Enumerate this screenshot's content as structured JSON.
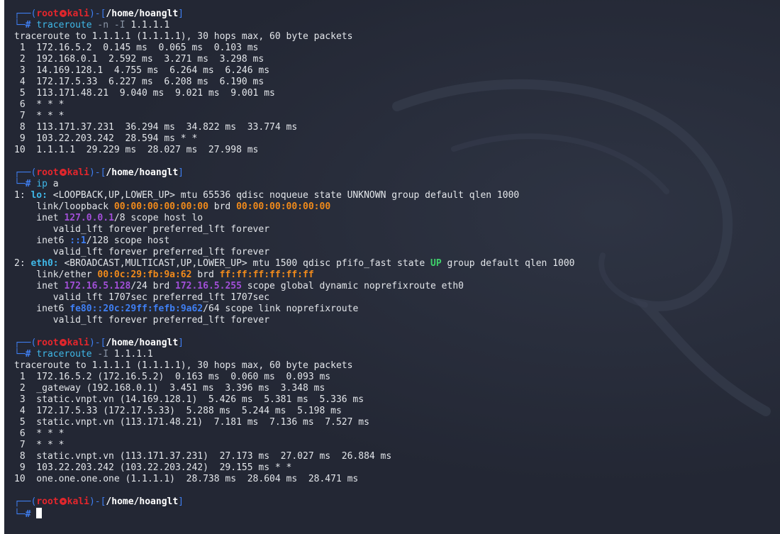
{
  "prompt": {
    "open": "┌──(",
    "user": "root",
    "host": "kali",
    "mid": ")-[",
    "path": "/home/hoanglt",
    "close": "]",
    "second": "└─",
    "hash": "#"
  },
  "block1": {
    "cmd": "traceroute",
    "opts": " -n -I",
    "arg": " 1.1.1.1",
    "header": "traceroute to 1.1.1.1 (1.1.1.1), 30 hops max, 60 byte packets",
    "hops": [
      " 1  172.16.5.2  0.145 ms  0.065 ms  0.103 ms",
      " 2  192.168.0.1  2.592 ms  3.271 ms  3.298 ms",
      " 3  14.169.128.1  4.755 ms  6.264 ms  6.246 ms",
      " 4  172.17.5.33  6.227 ms  6.208 ms  6.190 ms",
      " 5  113.171.48.21  9.040 ms  9.021 ms  9.001 ms",
      " 6  * * *",
      " 7  * * *",
      " 8  113.171.37.231  36.294 ms  34.822 ms  33.774 ms",
      " 9  103.22.203.242  28.594 ms * *",
      "10  1.1.1.1  29.229 ms  28.027 ms  27.998 ms"
    ]
  },
  "block2": {
    "cmd": "ip",
    "arg": " a",
    "lo": {
      "num": "1: ",
      "name": "lo:",
      "rest": " <LOOPBACK,UP,LOWER_UP> mtu 65536 qdisc noqueue state UNKNOWN group default qlen 1000",
      "link_pre": "    link/loopback ",
      "mac": "00:00:00:00:00:00",
      "brd_label": " brd ",
      "brd": "00:00:00:00:00:00",
      "inet_pre": "    inet ",
      "ip4": "127.0.0.1",
      "inet_post": "/8 scope host lo",
      "valid1": "       valid_lft forever preferred_lft forever",
      "inet6_pre": "    inet6 ",
      "ip6": "::1",
      "inet6_post": "/128 scope host",
      "valid2": "       valid_lft forever preferred_lft forever"
    },
    "eth0": {
      "num": "2: ",
      "name": "eth0:",
      "rest1": " <BROADCAST,MULTICAST,UP,LOWER_UP> mtu 1500 qdisc pfifo_fast state ",
      "state": "UP",
      "rest2": " group default qlen 1000",
      "link_pre": "    link/ether ",
      "mac": "00:0c:29:fb:9a:62",
      "brd_label": " brd ",
      "brd": "ff:ff:ff:ff:ff:ff",
      "inet_pre": "    inet ",
      "ip4": "172.16.5.128",
      "inet_mid": "/24 brd ",
      "ip4_brd": "172.16.5.255",
      "inet_post": " scope global dynamic noprefixroute eth0",
      "valid1": "       valid_lft 1707sec preferred_lft 1707sec",
      "inet6_pre": "    inet6 ",
      "ip6": "fe80::20c:29ff:fefb:9a62",
      "inet6_post": "/64 scope link noprefixroute",
      "valid2": "       valid_lft forever preferred_lft forever"
    }
  },
  "block3": {
    "cmd": "traceroute",
    "opts": " -I",
    "arg": " 1.1.1.1",
    "header": "traceroute to 1.1.1.1 (1.1.1.1), 30 hops max, 60 byte packets",
    "hops": [
      " 1  172.16.5.2 (172.16.5.2)  0.163 ms  0.060 ms  0.093 ms",
      " 2  _gateway (192.168.0.1)  3.451 ms  3.396 ms  3.348 ms",
      " 3  static.vnpt.vn (14.169.128.1)  5.426 ms  5.381 ms  5.336 ms",
      " 4  172.17.5.33 (172.17.5.33)  5.288 ms  5.244 ms  5.198 ms",
      " 5  static.vnpt.vn (113.171.48.21)  7.181 ms  7.136 ms  7.527 ms",
      " 6  * * *",
      " 7  * * *",
      " 8  static.vnpt.vn (113.171.37.231)  27.173 ms  27.027 ms  26.884 ms",
      " 9  103.22.203.242 (103.22.203.242)  29.155 ms * *",
      "10  one.one.one.one (1.1.1.1)  28.738 ms  28.604 ms  28.471 ms"
    ]
  },
  "colors": {
    "background": "#232734",
    "prompt_frame": "#3f7ff3",
    "root_user": "#e5262c",
    "command": "#3fb8e8",
    "mac": "#f08a1b",
    "ipv4": "#a24fd8",
    "state_up": "#3fd26b"
  },
  "icons": {
    "watermark": "kali-dragon-icon",
    "prompt_separator": "skull-icon"
  }
}
